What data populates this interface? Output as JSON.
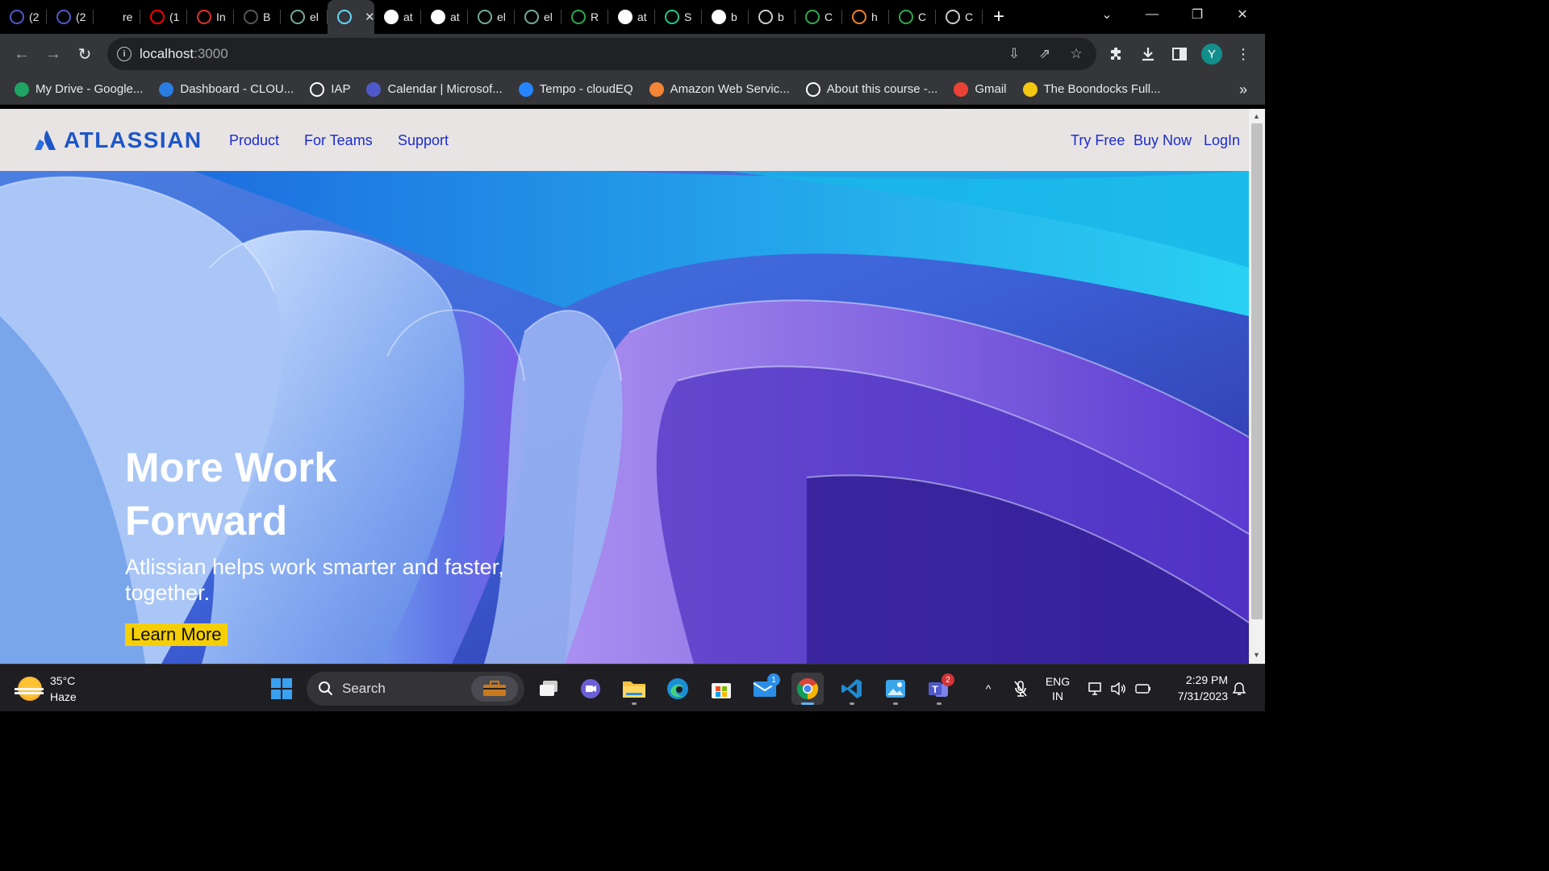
{
  "browser": {
    "tabs": [
      {
        "title": "(2",
        "icon": "teams-icon",
        "color": "#5059c9"
      },
      {
        "title": "(2",
        "icon": "teams-icon",
        "color": "#5059c9"
      },
      {
        "title": "re",
        "icon": "github-icon",
        "color": "#000000"
      },
      {
        "title": "(1",
        "icon": "youtube-icon",
        "color": "#ff0000"
      },
      {
        "title": "In",
        "icon": "gauge-icon",
        "color": "#e0312f"
      },
      {
        "title": "B",
        "icon": "document-icon",
        "color": "#555555"
      },
      {
        "title": "el",
        "icon": "openai-icon",
        "color": "#74aa9c"
      },
      {
        "title": "",
        "icon": "react-icon",
        "color": "#61dafb",
        "active": true
      },
      {
        "title": "at",
        "icon": "google-icon",
        "color": "#ffffff"
      },
      {
        "title": "at",
        "icon": "page-icon",
        "color": "#ffffff"
      },
      {
        "title": "el",
        "icon": "openai-icon",
        "color": "#74aa9c"
      },
      {
        "title": "el",
        "icon": "openai-icon",
        "color": "#74aa9c"
      },
      {
        "title": "R",
        "icon": "w-icon",
        "color": "#2fa84f"
      },
      {
        "title": "at",
        "icon": "google-icon",
        "color": "#ffffff"
      },
      {
        "title": "S",
        "icon": "vuetify-icon",
        "color": "#1ec98b"
      },
      {
        "title": "b",
        "icon": "google-icon",
        "color": "#ffffff"
      },
      {
        "title": "b",
        "icon": "m-icon",
        "color": "#cccccc"
      },
      {
        "title": "C",
        "icon": "w-icon",
        "color": "#2fa84f"
      },
      {
        "title": "h",
        "icon": "stackoverflow-icon",
        "color": "#f48024"
      },
      {
        "title": "C",
        "icon": "w-icon",
        "color": "#2fa84f"
      },
      {
        "title": "C",
        "icon": "angular-icon",
        "color": "#cccccc"
      }
    ],
    "new_tab": "+",
    "url_host": "localhost",
    "url_port": ":3000",
    "profile_initial": "Y",
    "bookmarks": [
      {
        "label": "My Drive - Google...",
        "icon": "drive-icon",
        "color": "#1fa463"
      },
      {
        "label": "Dashboard - CLOU...",
        "icon": "dashboard-icon",
        "color": "#2a7de1"
      },
      {
        "label": "IAP",
        "icon": "globe-icon",
        "color": "#ffffff"
      },
      {
        "label": "Calendar | Microsof...",
        "icon": "teams-icon",
        "color": "#5059c9"
      },
      {
        "label": "Tempo - cloudEQ",
        "icon": "tempo-icon",
        "color": "#2684ff"
      },
      {
        "label": "Amazon Web Servic...",
        "icon": "aws-icon",
        "color": "#f58536"
      },
      {
        "label": "About this course -...",
        "icon": "globe-icon",
        "color": "#ffffff"
      },
      {
        "label": "Gmail",
        "icon": "gmail-icon",
        "color": "#ea4335"
      },
      {
        "label": "The Boondocks Full...",
        "icon": "film-icon",
        "color": "#f2c811"
      }
    ],
    "bookmarks_more": "»"
  },
  "site": {
    "logo_text": "ATLASSIAN",
    "nav_left": [
      "Product",
      "For Teams",
      "Support"
    ],
    "nav_right": [
      "Try Free",
      "Buy Now",
      "LogIn"
    ],
    "hero_title": "More Work Forward",
    "hero_subtitle": "Atlissian helps work smarter and faster, together.",
    "hero_button": "Learn More",
    "brand_color": "#1d57c7",
    "link_color": "#1c2bcc",
    "button_color": "#f5cf05"
  },
  "taskbar": {
    "weather_temp": "35°C",
    "weather_desc": "Haze",
    "search_placeholder": "Search",
    "mail_badge": "1",
    "teams_badge": "2",
    "lang_1": "ENG",
    "lang_2": "IN",
    "time": "2:29 PM",
    "date": "7/31/2023"
  }
}
